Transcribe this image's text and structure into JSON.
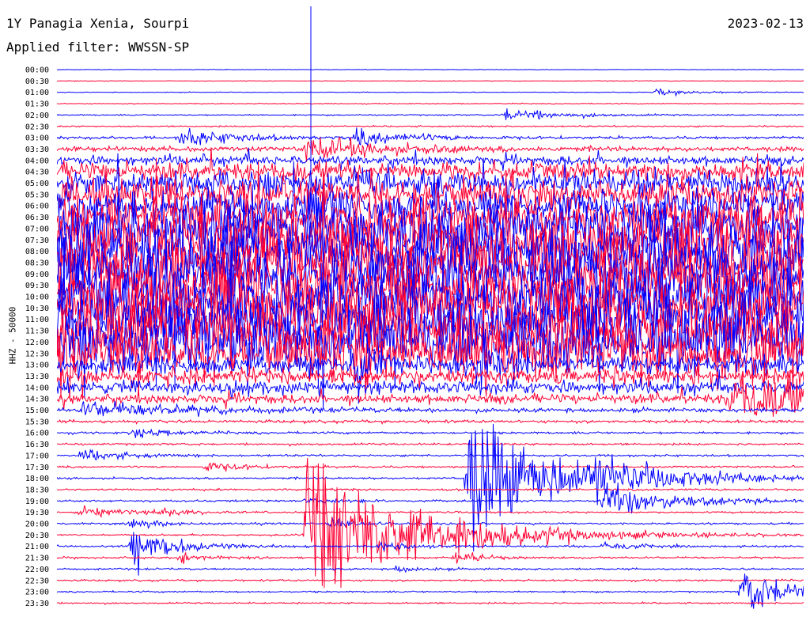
{
  "header": {
    "station": "1Y Panagia Xenia, Sourpi",
    "date": "2023-02-13",
    "filter": "Applied filter: WWSSN-SP"
  },
  "chart_data": {
    "type": "line",
    "ylabel": "HHZ - 50000",
    "colors": [
      "#0000ff",
      "#ff0033"
    ],
    "time_labels": [
      "00:00",
      "00:30",
      "01:00",
      "01:30",
      "02:00",
      "02:30",
      "03:00",
      "03:30",
      "04:00",
      "04:30",
      "05:00",
      "05:30",
      "06:00",
      "06:30",
      "07:00",
      "07:30",
      "08:00",
      "08:30",
      "09:00",
      "09:30",
      "10:00",
      "10:30",
      "11:00",
      "11:30",
      "12:00",
      "12:30",
      "13:00",
      "13:30",
      "14:00",
      "14:30",
      "15:00",
      "15:30",
      "16:00",
      "16:30",
      "17:00",
      "17:30",
      "18:00",
      "18:30",
      "19:00",
      "19:30",
      "20:00",
      "20:30",
      "21:00",
      "21:30",
      "22:00",
      "22:30",
      "23:00",
      "23:30"
    ],
    "noise_level": [
      0.3,
      0.4,
      0.4,
      0.5,
      0.7,
      0.8,
      1.5,
      2.5,
      5,
      10,
      14,
      16,
      18,
      22,
      30,
      32,
      32,
      32,
      32,
      32,
      32,
      32,
      32,
      32,
      32,
      30,
      10,
      8,
      7,
      5,
      2.2,
      1.6,
      1.2,
      1.2,
      1.1,
      1.1,
      1.1,
      1.1,
      1.1,
      1.0,
      1.0,
      1.0,
      1.0,
      1.0,
      1.0,
      1.0,
      0.9,
      0.9
    ],
    "events": [
      {
        "row": 2,
        "minute": 24,
        "amp": 4,
        "dur": 1.5
      },
      {
        "row": 4,
        "minute": 18,
        "amp": 8,
        "dur": 2
      },
      {
        "row": 6,
        "minute": 5,
        "amp": 11,
        "dur": 2
      },
      {
        "row": 6,
        "minute": 12,
        "amp": 10,
        "dur": 2
      },
      {
        "row": 7,
        "minute": 10,
        "amp": 14,
        "dur": 3
      },
      {
        "row": 13,
        "minute": 12,
        "amp": 40,
        "dur": 0.5
      },
      {
        "row": 26,
        "minute": 12,
        "amp": 60,
        "dur": 0.5
      },
      {
        "row": 26,
        "minute": 17,
        "amp": 30,
        "dur": 0.5
      },
      {
        "row": 29,
        "minute": 27,
        "amp": 26,
        "dur": 5
      },
      {
        "row": 29,
        "minute": 29,
        "amp": 10,
        "dur": 1
      },
      {
        "row": 30,
        "minute": 1,
        "amp": 10,
        "dur": 4
      },
      {
        "row": 32,
        "minute": 3,
        "amp": 6,
        "dur": 1.5
      },
      {
        "row": 34,
        "minute": 1,
        "amp": 8,
        "dur": 1.5
      },
      {
        "row": 35,
        "minute": 6,
        "amp": 6,
        "dur": 1.5
      },
      {
        "row": 36,
        "minute": 16.5,
        "amp": 90,
        "dur": 3
      },
      {
        "row": 36,
        "minute": 21.5,
        "amp": 16,
        "dur": 3
      },
      {
        "row": 38,
        "minute": 22,
        "amp": 22,
        "dur": 2.5
      },
      {
        "row": 38,
        "minute": 10,
        "amp": 6,
        "dur": 1
      },
      {
        "row": 39,
        "minute": 1,
        "amp": 6,
        "dur": 1.5
      },
      {
        "row": 39,
        "minute": 4,
        "amp": 6,
        "dur": 1
      },
      {
        "row": 40,
        "minute": 3,
        "amp": 7,
        "dur": 1
      },
      {
        "row": 40,
        "minute": 11,
        "amp": 7,
        "dur": 1
      },
      {
        "row": 41,
        "minute": 10,
        "amp": 90,
        "dur": 4
      },
      {
        "row": 41,
        "minute": 16,
        "amp": 8,
        "dur": 1.5
      },
      {
        "row": 42,
        "minute": 3,
        "amp": 30,
        "dur": 1.5
      },
      {
        "row": 42,
        "minute": 13,
        "amp": 7,
        "dur": 1
      },
      {
        "row": 42,
        "minute": 22,
        "amp": 7,
        "dur": 1
      },
      {
        "row": 43,
        "minute": 5,
        "amp": 6,
        "dur": 1
      },
      {
        "row": 43,
        "minute": 16,
        "amp": 8,
        "dur": 1
      },
      {
        "row": 44,
        "minute": 13.5,
        "amp": 4,
        "dur": 1
      },
      {
        "row": 46,
        "minute": 27.5,
        "amp": 30,
        "dur": 2
      }
    ]
  }
}
